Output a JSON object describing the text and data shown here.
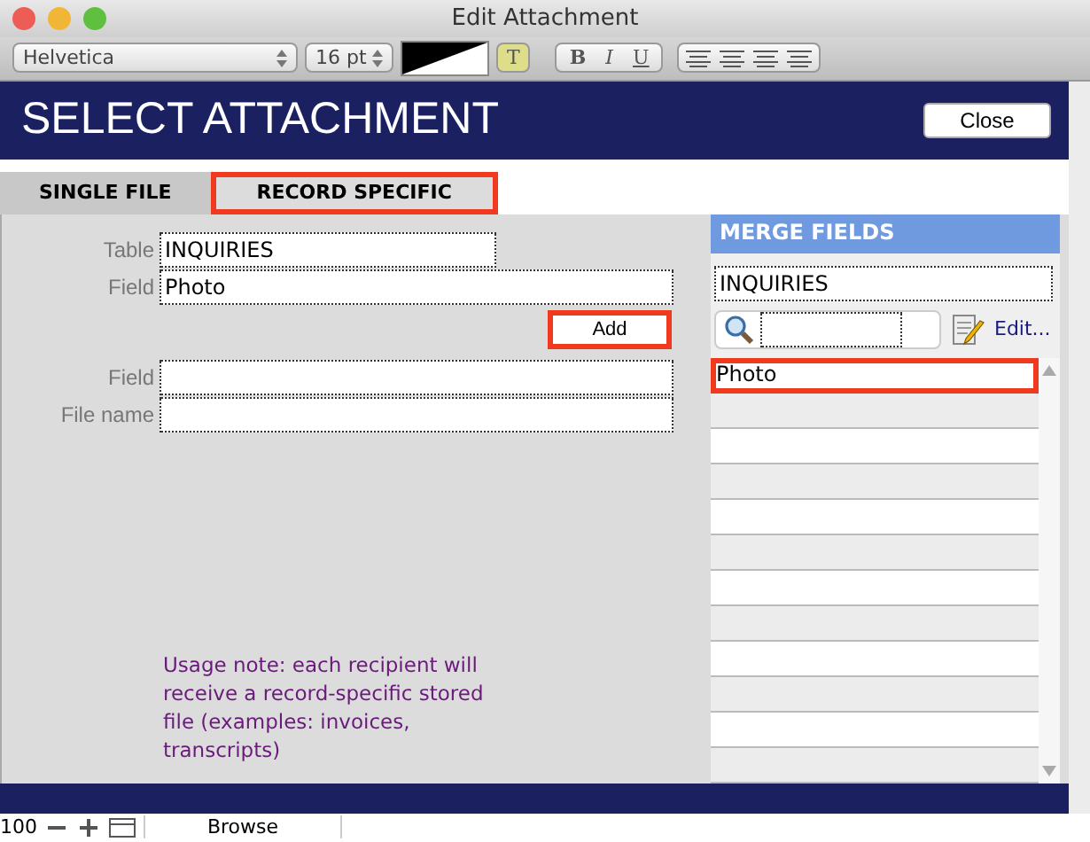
{
  "window": {
    "title": "Edit Attachment"
  },
  "toolbar": {
    "font": "Helvetica",
    "size": "16 pt",
    "text_button": "T",
    "style_buttons": [
      "B",
      "I",
      "U"
    ]
  },
  "header": {
    "title": "SELECT ATTACHMENT",
    "close_button": "Close"
  },
  "tabs": [
    {
      "label": "SINGLE FILE",
      "selected": false,
      "highlighted": false
    },
    {
      "label": "RECORD SPECIFIC",
      "selected": true,
      "highlighted": true
    }
  ],
  "form": {
    "table_label": "Table",
    "table_value": "INQUIRIES",
    "field_label": "Field",
    "field_value": "Photo",
    "add_button": {
      "label": "Add",
      "highlighted": true
    },
    "field2_label": "Field",
    "file_label": "File name",
    "note": "Usage note: each recipient will receive a record-specific stored file (examples: invoices, transcripts)"
  },
  "merge": {
    "title": "MERGE FIELDS",
    "table": "INQUIRIES",
    "edit_link": "Edit...",
    "items": [
      {
        "label": "Photo",
        "highlighted": true
      }
    ]
  },
  "status_bar": {
    "zoom": "100",
    "mode": "Browse"
  }
}
